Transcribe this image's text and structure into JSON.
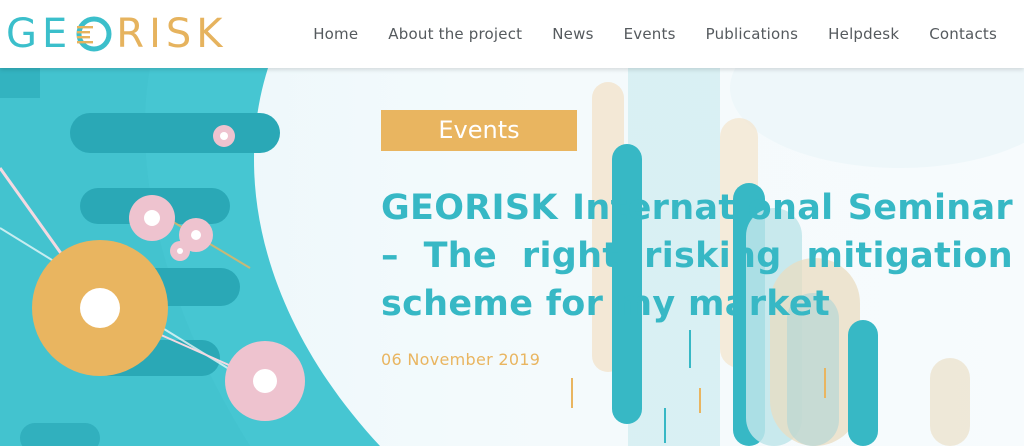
{
  "header": {
    "logo": {
      "part1": "GE",
      "part2": "RISK"
    },
    "nav": [
      "Home",
      "About the project",
      "News",
      "Events",
      "Publications",
      "Helpdesk",
      "Contacts"
    ]
  },
  "hero": {
    "badge": "Events",
    "title": "GEORISK International Seminar – The right risking mitigation scheme for my market",
    "date": "06 November 2019"
  },
  "colors": {
    "teal": "#3bbfcb",
    "gold": "#e9b560",
    "pink": "#eec3cf",
    "nav_text": "#555a5e"
  }
}
